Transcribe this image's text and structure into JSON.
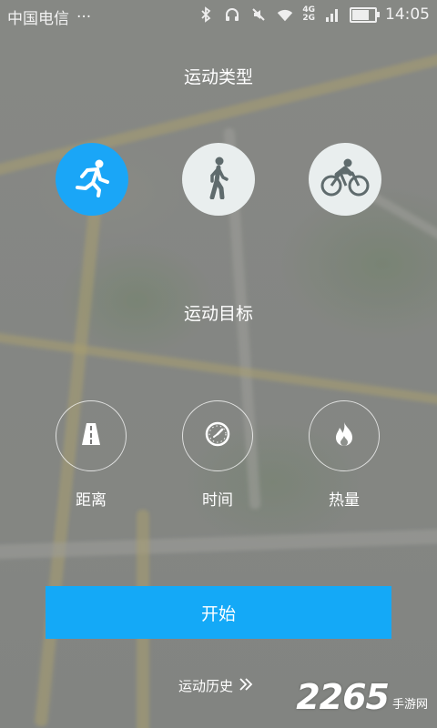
{
  "status_bar": {
    "carrier": "中国电信",
    "more": "···",
    "network_top": "4G",
    "network_bottom": "2G",
    "time": "14:05",
    "battery_level": 0.7,
    "icons": [
      "bluetooth-icon",
      "headphones-icon",
      "mute-icon",
      "wifi-icon",
      "signal-icon",
      "battery-icon"
    ]
  },
  "sport_type": {
    "title": "运动类型",
    "options": [
      {
        "name": "running",
        "icon": "running-icon",
        "active": true
      },
      {
        "name": "walking",
        "icon": "walking-icon",
        "active": false
      },
      {
        "name": "cycling",
        "icon": "cycling-icon",
        "active": false
      }
    ]
  },
  "goal": {
    "title": "运动目标",
    "options": [
      {
        "label": "距离",
        "icon": "road-icon"
      },
      {
        "label": "时间",
        "icon": "clock-icon"
      },
      {
        "label": "热量",
        "icon": "flame-icon"
      }
    ]
  },
  "start_label": "开始",
  "history_label": "运动历史",
  "watermark": {
    "number": "2265",
    "text": "手游网"
  },
  "colors": {
    "accent": "#1aa6f7",
    "inactive_circle": "#e9eeee",
    "icon_dark": "#5f6b6d"
  }
}
